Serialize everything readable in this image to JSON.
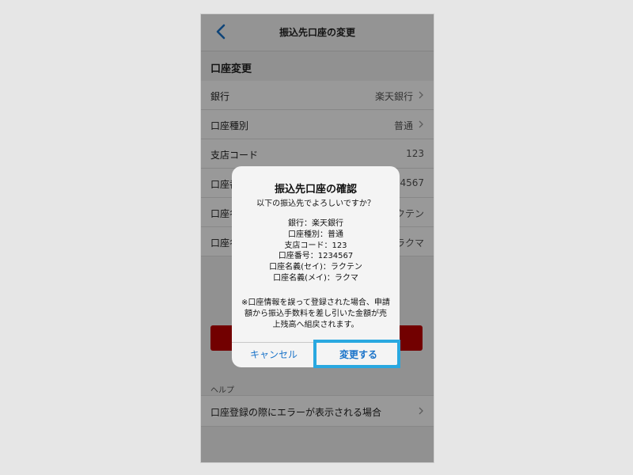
{
  "navbar": {
    "back_icon": "chevron-left-icon",
    "title": "振込先口座の変更"
  },
  "section": {
    "title": "口座変更"
  },
  "form_rows": [
    {
      "label": "銀行",
      "value": "楽天銀行",
      "arrow": true
    },
    {
      "label": "口座種別",
      "value": "普通",
      "arrow": true
    },
    {
      "label": "支店コード",
      "value": "123",
      "arrow": false
    },
    {
      "label": "口座番号",
      "value": "1234567",
      "arrow": false
    },
    {
      "label": "口座名義(セイ)",
      "value": "ラクテン",
      "arrow": false
    },
    {
      "label": "口座名義(メイ)",
      "value": "ラクマ",
      "arrow": false
    }
  ],
  "help": {
    "heading": "ヘルプ",
    "item": "口座登録の際にエラーが表示される場合"
  },
  "dialog": {
    "title": "振込先口座の確認",
    "subtitle": "以下の振込先でよろしいですか？",
    "details": [
      "銀行：楽天銀行",
      "口座種別：普通",
      "支店コード：123",
      "口座番号：1234567",
      "口座名義(セイ)：ラクテン",
      "口座名義(メイ)：ラクマ"
    ],
    "warning": "※口座情報を誤って登録された場合、申請額から振込手数料を差し引いた金額が売上残高へ組戻されます。",
    "cancel_label": "キャンセル",
    "confirm_label": "変更する"
  },
  "colors": {
    "accent": "#1a73c9",
    "highlight": "#29a8e0",
    "submit_button": "#bf0000"
  }
}
